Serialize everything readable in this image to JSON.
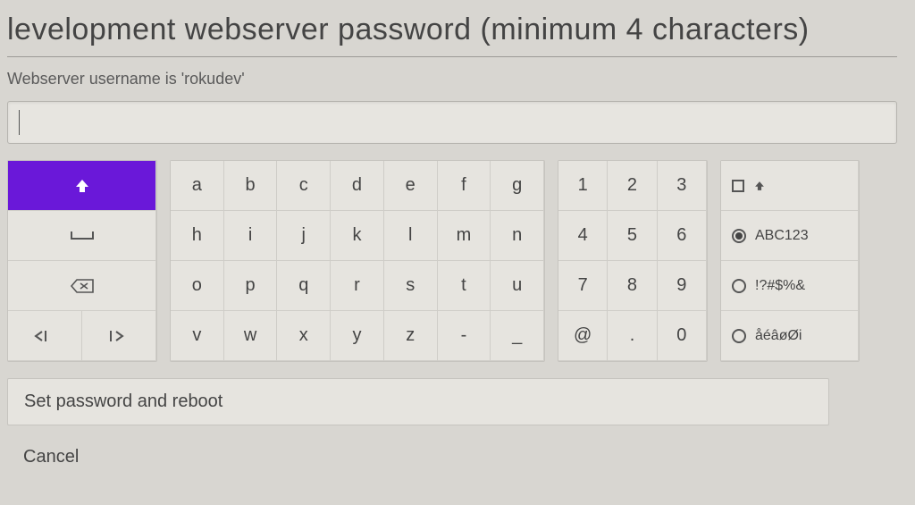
{
  "title": "levelopment webserver password (minimum 4 characters)",
  "hint": "Webserver username is 'rokudev'",
  "input": {
    "value": ""
  },
  "keyboard": {
    "letters": [
      "a",
      "b",
      "c",
      "d",
      "e",
      "f",
      "g",
      "h",
      "i",
      "j",
      "k",
      "l",
      "m",
      "n",
      "o",
      "p",
      "q",
      "r",
      "s",
      "t",
      "u",
      "v",
      "w",
      "x",
      "y",
      "z",
      "-",
      "_"
    ],
    "numbers": [
      "1",
      "2",
      "3",
      "4",
      "5",
      "6",
      "7",
      "8",
      "9",
      "@",
      ".",
      "0"
    ],
    "modes": {
      "caps": "",
      "abc": "ABC123",
      "sym": "!?#$%&",
      "intl": "åéâøØi"
    },
    "selected_mode": "abc"
  },
  "actions": {
    "confirm": "Set password and reboot",
    "cancel": "Cancel"
  }
}
